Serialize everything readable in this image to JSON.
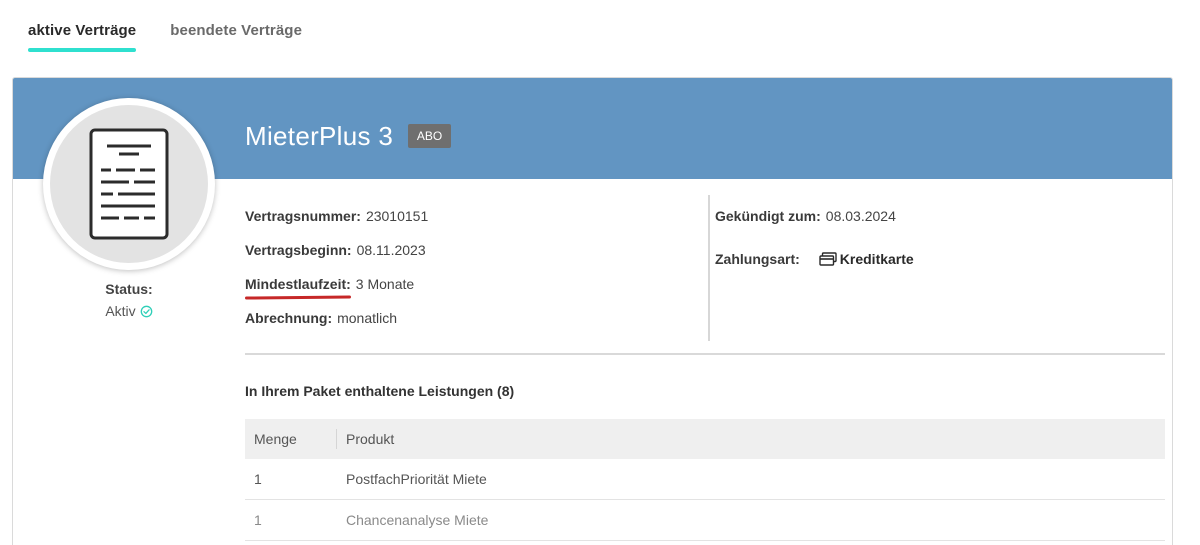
{
  "tabs": [
    {
      "label": "aktive Verträge",
      "active": true
    },
    {
      "label": "beendete Verträge",
      "active": false
    }
  ],
  "contract": {
    "title": "MieterPlus 3",
    "badge": "ABO",
    "icon": "document-icon",
    "status_label": "Status:",
    "status_value": "Aktiv",
    "status_icon": "check-circle-icon",
    "fields_left": [
      {
        "label": "Vertragsnummer:",
        "value": "23010151"
      },
      {
        "label": "Vertragsbeginn:",
        "value": "08.11.2023"
      },
      {
        "label": "Mindestlaufzeit:",
        "value": "3 Monate"
      },
      {
        "label": "Abrechnung:",
        "value": "monatlich"
      }
    ],
    "cancelled": {
      "label": "Gekündigt zum:",
      "value": "08.03.2024"
    },
    "payment": {
      "label": "Zahlungsart:",
      "value": "Kreditkarte",
      "icon": "credit-card-icon"
    }
  },
  "package": {
    "title": "In Ihrem Paket enthaltene Leistungen (8)",
    "columns": [
      "Menge",
      "Produkt"
    ],
    "rows": [
      {
        "qty": "1",
        "product": "PostfachPriorität Miete"
      },
      {
        "qty": "1",
        "product": "Chancenanalyse Miete"
      }
    ]
  },
  "colors": {
    "header_bg": "#6295c2",
    "tab_accent": "#2fe0cf",
    "badge_bg": "#6f6f6f",
    "status_ok": "#2fcfb8",
    "annotation_underline": "#c62828"
  }
}
